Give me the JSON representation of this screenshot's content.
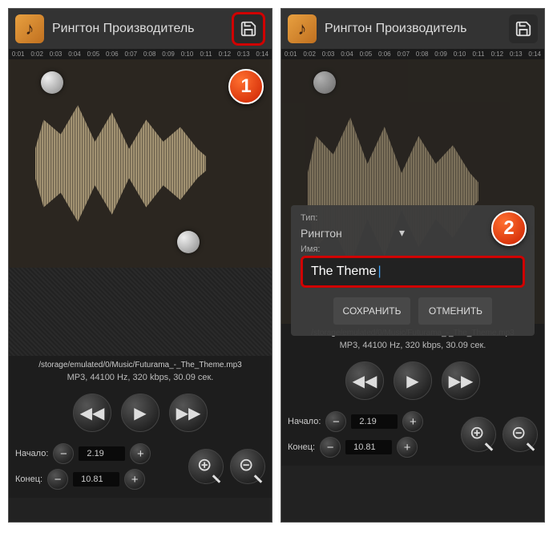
{
  "app": {
    "title": "Рингтон Производитель"
  },
  "timeline": [
    "0:01",
    "0:02",
    "0:03",
    "0:04",
    "0:05",
    "0:06",
    "0:07",
    "0:08",
    "0:09",
    "0:10",
    "0:11",
    "0:12",
    "0:13",
    "0:14"
  ],
  "file": {
    "path": "/storage/emulated/0/Music/Futurama_-_The_Theme.mp3",
    "info": "MP3, 44100 Hz, 320 kbps, 30.09 сек."
  },
  "range": {
    "start_label": "Начало:",
    "end_label": "Конец:",
    "start": "2.19",
    "end": "10.81"
  },
  "dialog": {
    "type_label": "Тип:",
    "type_value": "Рингтон",
    "name_label": "Имя:",
    "name_value": "The Theme",
    "save": "СОХРАНИТЬ",
    "cancel": "ОТМЕНИТЬ"
  },
  "callouts": {
    "one": "1",
    "two": "2"
  }
}
